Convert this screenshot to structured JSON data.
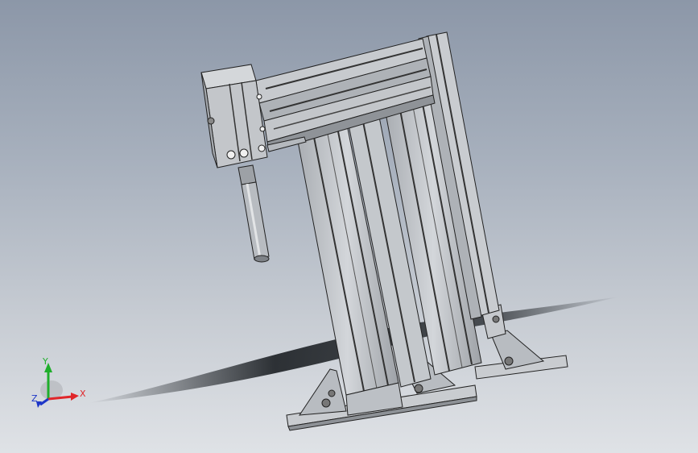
{
  "viewport": {
    "background_top": "#8c97a8",
    "background_bottom": "#dfe2e6"
  },
  "model": {
    "icon": "cad-assembly-icon",
    "frame_color": "#bfc3c8",
    "edge_color": "#222222",
    "shadow_color": "#101418"
  },
  "triad": {
    "x_label": "X",
    "y_label": "Y",
    "z_label": "Z",
    "x_color": "#e0262a",
    "y_color": "#1fae2b",
    "z_color": "#1d36c8"
  }
}
